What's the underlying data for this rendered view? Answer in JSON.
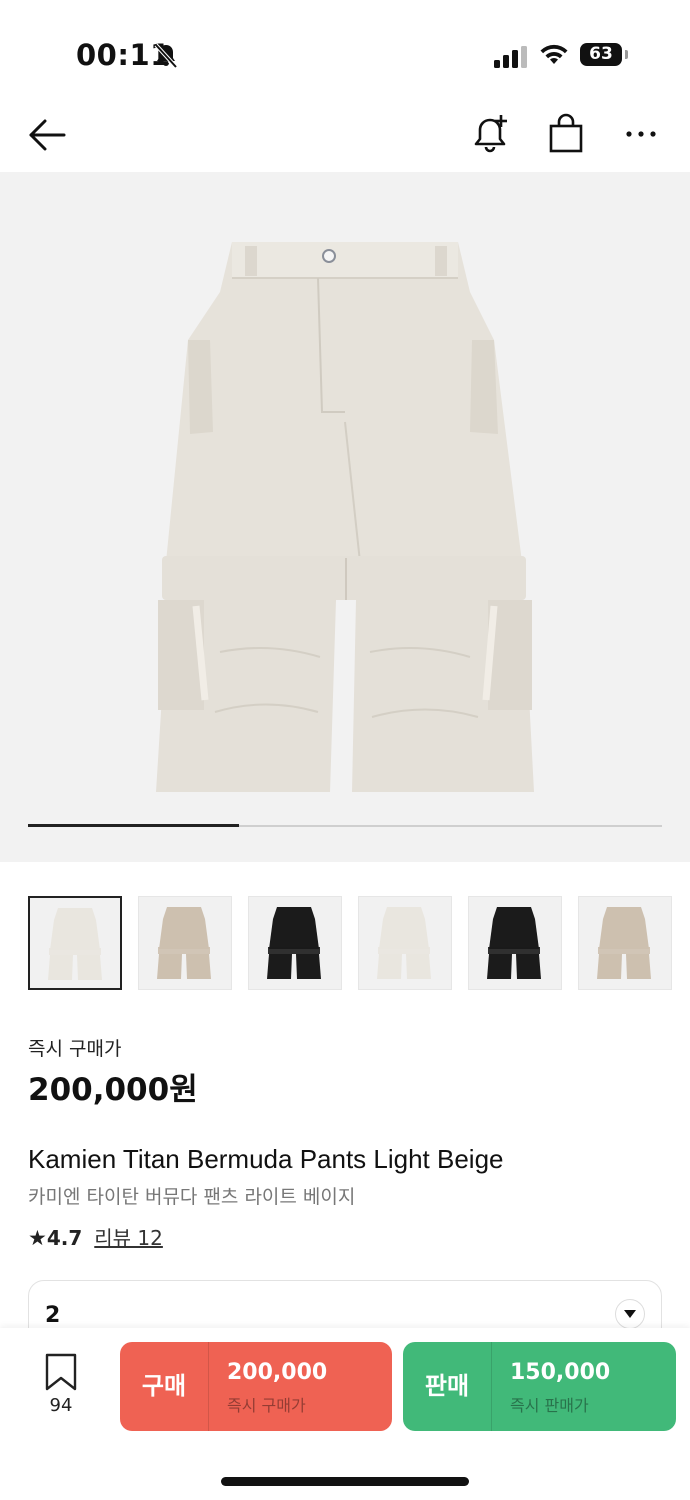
{
  "status": {
    "time": "00:11",
    "battery": "63"
  },
  "product": {
    "price_label": "즉시 구매가",
    "price": "200,000원",
    "name_en": "Kamien Titan Bermuda Pants Light Beige",
    "name_ko": "카미엔 타이탄 버뮤다 팬츠 라이트 베이지",
    "rating": "4.7",
    "review_label": "리뷰 12",
    "gallery_progress": 0.333
  },
  "thumbnails": [
    {
      "color": "#e9e6df",
      "selected": true
    },
    {
      "color": "#cdc0af",
      "selected": false
    },
    {
      "color": "#1b1b1b",
      "selected": false
    },
    {
      "color": "#e9e6df",
      "selected": false
    },
    {
      "color": "#1b1b1b",
      "selected": false
    },
    {
      "color": "#cdc0af",
      "selected": false
    }
  ],
  "size": {
    "selected": "2"
  },
  "bottom": {
    "wish_count": "94",
    "buy": {
      "label": "구매",
      "price": "200,000",
      "sub": "즉시 구매가",
      "color": "#ef6253"
    },
    "sell": {
      "label": "판매",
      "price": "150,000",
      "sub": "즉시 판매가",
      "color": "#41b979"
    }
  }
}
